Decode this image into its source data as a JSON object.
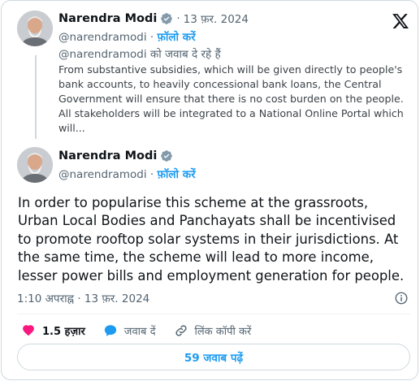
{
  "colors": {
    "accent": "#1d9bf0",
    "like_red": "#f91880",
    "secondary_text": "#536471",
    "border": "#cfd9de"
  },
  "quoted_tweet": {
    "author_name": "Narendra Modi",
    "date": "13 फ़र. 2024",
    "handle": "@narendramodi",
    "follow_label": "फ़ॉलो करें",
    "separator": "·",
    "reply_context": "@narendramodi को जवाब दे रहे हैं",
    "text": "From substantive subsidies, which will be given directly to people's bank accounts, to heavily concessional bank loans, the Central Government will ensure that there is no cost burden on the people. All stakeholders will be integrated to a National Online Portal which will..."
  },
  "main_tweet": {
    "author_name": "Narendra Modi",
    "handle": "@narendramodi",
    "follow_label": "फ़ॉलो करें",
    "separator": "·",
    "text": "In order to popularise this scheme at the grassroots, Urban Local Bodies and Panchayats shall be incentivised to promote rooftop solar systems in their jurisdictions. At the same time, the scheme will lead to more income, lesser power bills and employment generation for people.",
    "time": "1:10 अपराह्न",
    "date": "13 फ़र. 2024"
  },
  "actions": {
    "likes_count": "1.5 हज़ार",
    "reply_label": "जवाब दें",
    "copy_link_label": "लिंक कॉपी करें"
  },
  "read_replies_label": "59 जवाब पढ़ें",
  "icons": [
    "verified-badge-icon",
    "x-logo-icon",
    "info-icon",
    "heart-icon",
    "reply-bubble-icon",
    "link-icon"
  ]
}
